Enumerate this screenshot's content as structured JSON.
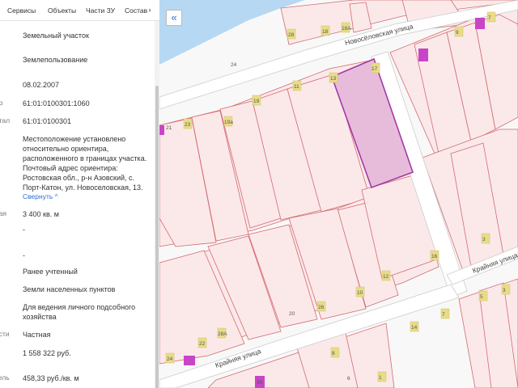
{
  "tabs": [
    "Сервисы",
    "Объекты",
    "Части ЗУ",
    "Состав"
  ],
  "tab_arrow": "›",
  "collapse_label": "«",
  "rows": [
    {
      "label": "",
      "value": "Земельный участок"
    },
    {
      "label": "",
      "value": "Землепользование"
    },
    {
      "label": "",
      "value": "08.02.2007"
    },
    {
      "label": "ер",
      "value": "61:01:0100301:1060"
    },
    {
      "label": "ртал",
      "value": "61:01:0100301"
    },
    {
      "label": "",
      "value": "Местоположение установлено относительно ориентира, расположенного в границах участка. Почтовый адрес ориентира: Ростовская обл., р-н Азовский, с. Порт-Катон, ул. Новоселовская, 13."
    },
    {
      "label": "ная",
      "value": "3 400 кв. м"
    },
    {
      "label": "",
      "value": "-"
    },
    {
      "label": "",
      "value": "-"
    },
    {
      "label": "",
      "value": "Ранее учтенный"
    },
    {
      "label": "",
      "value": "Земли населенных пунктов"
    },
    {
      "label": "",
      "value": "Для ведения личного подсобного хозяйства"
    },
    {
      "label": "ости",
      "value": "Частная"
    },
    {
      "label": "",
      "value": "1 558 322 руб."
    },
    {
      "label": "тель",
      "value": "458,33 руб./кв. м"
    }
  ],
  "collapse_link": "Свернуть ^",
  "map": {
    "streets": [
      "Новосёловская улица",
      "Крайняя улица",
      "Крайняя улица"
    ],
    "labels": [
      "28",
      "18",
      "18А",
      "24",
      "7",
      "9",
      "11",
      "13",
      "19",
      "23",
      "21",
      "19а",
      "17",
      "16",
      "14",
      "12",
      "10",
      "8",
      "3",
      "7",
      "5",
      "3",
      "1",
      "20",
      "22",
      "24",
      "26",
      "28А",
      "30",
      "6"
    ],
    "colors": {
      "parcel_fill": "#fbe9ea",
      "parcel_stroke": "#d46a6f",
      "selected_fill": "#e7bcdb",
      "selected_stroke": "#a23aa5",
      "water": "#b7d8f2",
      "label": "#d8c86b",
      "building": "#c845c8"
    }
  }
}
